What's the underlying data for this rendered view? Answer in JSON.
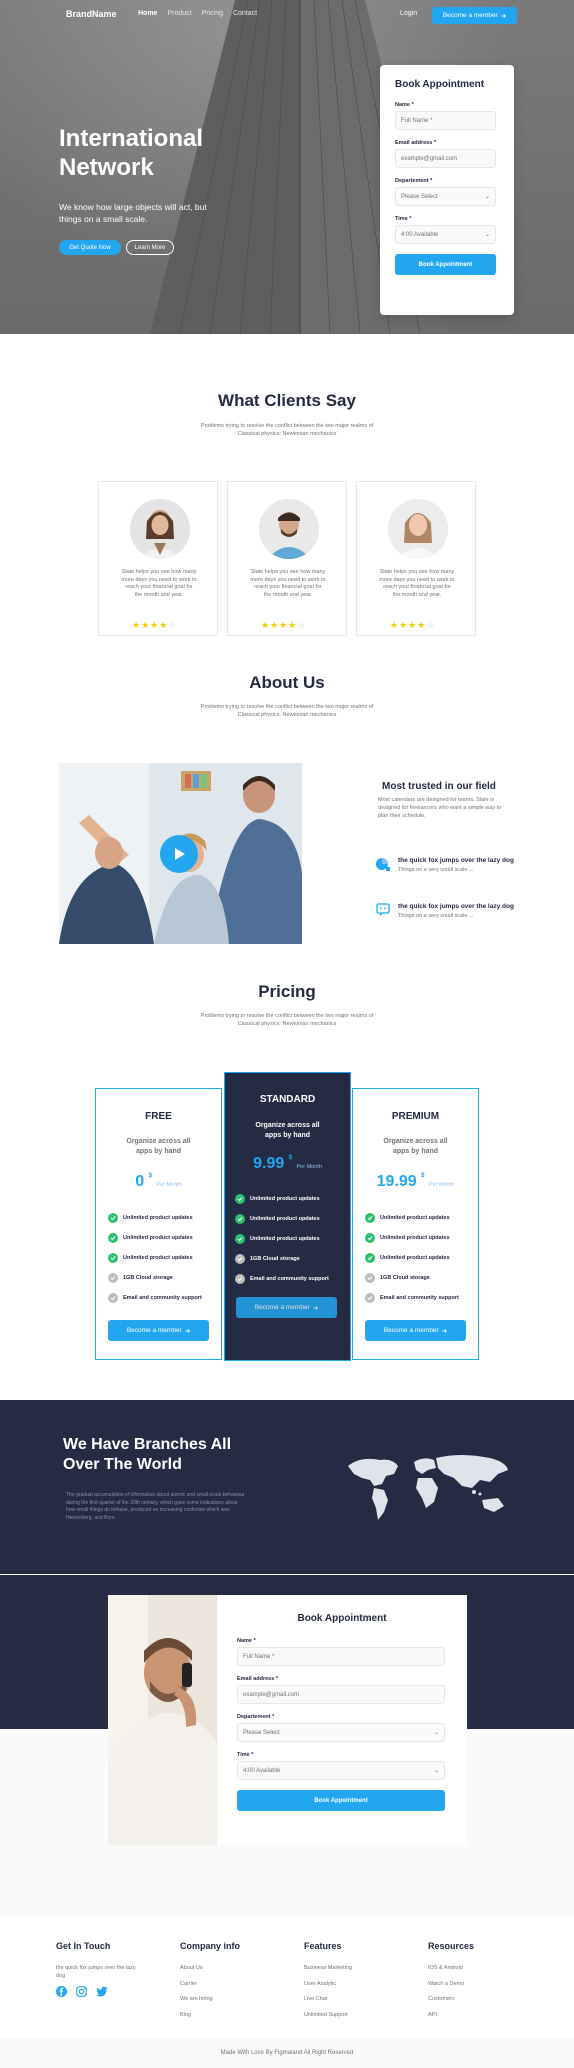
{
  "nav": {
    "brand": "BrandName",
    "links": [
      "Home",
      "Product",
      "Pricing",
      "Contact"
    ],
    "login": "Login",
    "cta": "Become a member"
  },
  "hero": {
    "title": "International Network",
    "subtitle": "We know how large objects will act, but things on a small scale.",
    "primary_btn": "Get Quote Now",
    "secondary_btn": "Learn More"
  },
  "booking": {
    "title": "Book Appointment",
    "name_label": "Name *",
    "name_placeholder": "Full Name *",
    "email_label": "Email address *",
    "email_placeholder": "example@gmail.com",
    "department_label": "Departement *",
    "department_value": "Please Select",
    "time_label": "Time *",
    "time_value": "4:00 Available",
    "submit": "Book Appointment"
  },
  "testimonials": {
    "title": "What Clients Say",
    "description": "Problems trying to resolve the conflict between the two major realms of Classical physics: Newtonian mechanics",
    "items": [
      {
        "text": "Slate helps you see how many more days you need to work to reach your financial goal for the month and year.",
        "stars": 4
      },
      {
        "text": "Slate helps you see how many more days you need to work to reach your financial goal for the month and year.",
        "stars": 4
      },
      {
        "text": "Slate helps you see how many more days you need to work to reach your financial goal for the month and year.",
        "stars": 4
      }
    ]
  },
  "about": {
    "title": "About Us",
    "description": "Problems trying to resolve the conflict between the two major realms of Classical physics: Newtonian mechanics",
    "trust_title": "Most trusted in our field",
    "trust_desc": "Most calendars are designed for teams. Slate is designed for freelancers who want a simple way to plan their schedule.",
    "features": [
      {
        "icon": "chart-icon",
        "title": "the quick fox jumps over the lazy dog",
        "sub": "Things on a very small scale ..."
      },
      {
        "icon": "chat-icon",
        "title": "the quick fox jumps over the lazy dog",
        "sub": "Things on a very small scale ..."
      }
    ]
  },
  "pricing": {
    "title": "Pricing",
    "description": "Problems trying to resolve the conflict between the two major realms of Classical physics: Newtonian mechanics",
    "plans": [
      {
        "name": "FREE",
        "desc": "Organize across all apps by hand",
        "price": "0",
        "currency": "$",
        "per": "Per Month",
        "button": "Become a member",
        "features": [
          {
            "text": "Unlimited product updates",
            "on": true
          },
          {
            "text": "Unlimited product updates",
            "on": true
          },
          {
            "text": "Unlimited product updates",
            "on": true
          },
          {
            "text": "1GB Cloud storage",
            "on": false
          },
          {
            "text": "Email and community support",
            "on": false
          }
        ]
      },
      {
        "name": "STANDARD",
        "desc": "Organize across all apps by hand",
        "price": "9.99",
        "currency": "$",
        "per": "Per Month",
        "button": "Become a member",
        "features": [
          {
            "text": "Unlimited product updates",
            "on": true
          },
          {
            "text": "Unlimited product updates",
            "on": true
          },
          {
            "text": "Unlimited product updates",
            "on": true
          },
          {
            "text": "1GB Cloud storage",
            "on": false
          },
          {
            "text": "Email and community support",
            "on": false
          }
        ]
      },
      {
        "name": "PREMIUM",
        "desc": "Organize across all apps by hand",
        "price": "19.99",
        "currency": "$",
        "per": "Per Month",
        "button": "Become a member",
        "features": [
          {
            "text": "Unlimited product updates",
            "on": true
          },
          {
            "text": "Unlimited product updates",
            "on": true
          },
          {
            "text": "Unlimited product updates",
            "on": true
          },
          {
            "text": "1GB Cloud storage",
            "on": false
          },
          {
            "text": "Email and community support",
            "on": false
          }
        ]
      }
    ]
  },
  "branches": {
    "title": "We Have Branches All Over The World",
    "description": "The gradual accumulation of information about atomic and small-scale behaviour during the first quarter of the 20th century, which gave some indications about how small things do behave, produced an increasing confusion which was Heisenberg, and Born."
  },
  "booking2": {
    "title": "Book Appointment",
    "name_label": "Name *",
    "name_placeholder": "Full Name *",
    "email_label": "Email address *",
    "email_placeholder": "example@gmail.com",
    "department_label": "Departement *",
    "department_value": "Please Select",
    "time_label": "Time *",
    "time_value": "4:00 Available",
    "submit": "Book Appointment"
  },
  "footer": {
    "get_in_touch": {
      "title": "Get In Touch",
      "text": "the quick fox jumps over the lazy dog"
    },
    "columns": [
      {
        "title": "Company info",
        "items": [
          "About Us",
          "Carrier",
          "We are hiring",
          "Blog"
        ]
      },
      {
        "title": "Features",
        "items": [
          "Business Marketing",
          "User Analytic",
          "Live Chat",
          "Unlimited Support"
        ]
      },
      {
        "title": "Resources",
        "items": [
          "IOS & Android",
          "Watch a Demo",
          "Customers",
          "API"
        ]
      }
    ],
    "copyright": "Made With Love By Figmaland All Right Reserved"
  },
  "colors": {
    "primary": "#23A6F0",
    "dark": "#252B42",
    "success": "#2DC071",
    "star": "#F3CD03"
  }
}
